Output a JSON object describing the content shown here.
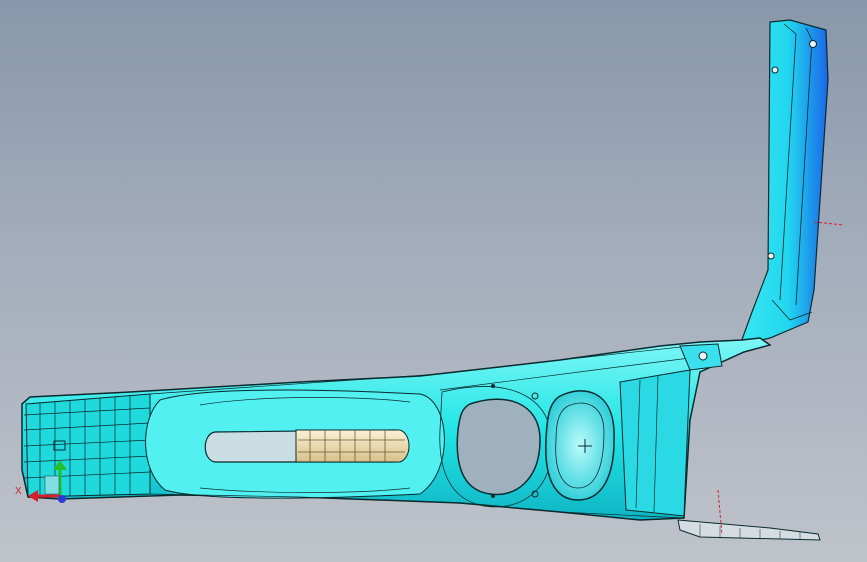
{
  "viewport": {
    "model": "center-console-part",
    "background_top": "#8897ab",
    "background_bottom": "#bfc3ca"
  },
  "model_colors": {
    "surface": "#22e6e6",
    "surface_light": "#7ff6f6",
    "surface_dark": "#0fb5c4",
    "edge": "#0a2a2e",
    "accent_blue": "#1a66e8",
    "insert": "#f1e3b8"
  },
  "axis_triad": {
    "x_label": "X",
    "x_color": "#d81f2a",
    "y_color": "#22c02a",
    "z_color": "#2a3ad8"
  }
}
